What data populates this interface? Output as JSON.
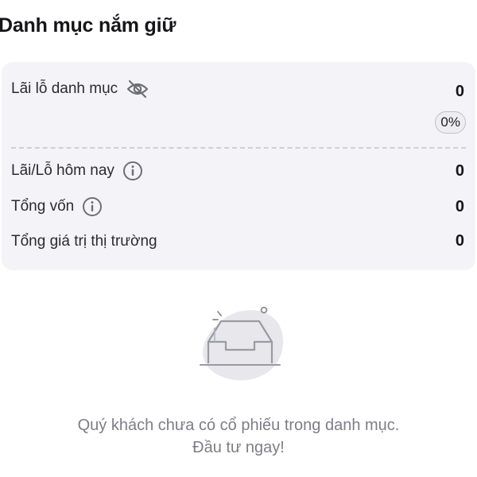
{
  "header": {
    "title": "Danh mục nắm giữ"
  },
  "portfolio": {
    "pnl": {
      "label": "Lãi lỗ danh mục",
      "value": "0",
      "percent": "0%",
      "visibility_icon": "eye-off-icon"
    },
    "today_pnl": {
      "label": "Lãi/Lỗ hôm nay",
      "value": "0",
      "info_icon": "info-icon"
    },
    "total_capital": {
      "label": "Tổng vốn",
      "value": "0",
      "info_icon": "info-icon"
    },
    "market_value": {
      "label": "Tổng giá trị thị trường",
      "value": "0"
    }
  },
  "empty_state": {
    "icon": "empty-inbox-icon",
    "line1": "Quý khách chưa có cổ phiếu trong danh mục.",
    "line2": "Đầu tư ngay!"
  },
  "colors": {
    "card_background": "#f4f4f8",
    "icon_gray": "#6e6e78",
    "muted_text": "#7d7d86"
  }
}
